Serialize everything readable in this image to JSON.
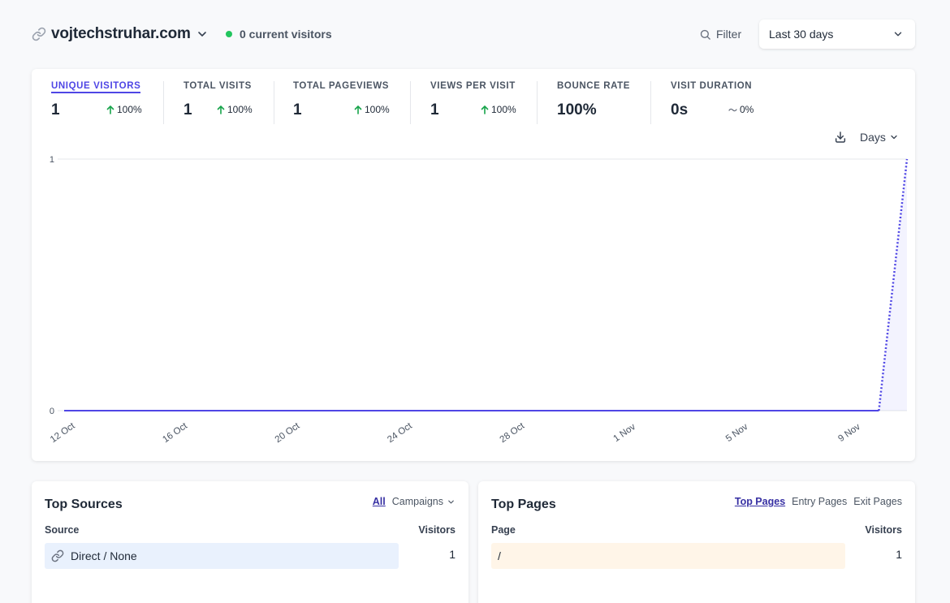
{
  "header": {
    "site_name": "vojtechstruhar.com",
    "live_visitors": "0 current visitors",
    "filter_label": "Filter",
    "date_range": "Last 30 days"
  },
  "metrics": [
    {
      "label": "UNIQUE VISITORS",
      "value": "1",
      "change": "100%",
      "trend": "up",
      "active": true
    },
    {
      "label": "TOTAL VISITS",
      "value": "1",
      "change": "100%",
      "trend": "up",
      "active": false
    },
    {
      "label": "TOTAL PAGEVIEWS",
      "value": "1",
      "change": "100%",
      "trend": "up",
      "active": false
    },
    {
      "label": "VIEWS PER VISIT",
      "value": "1",
      "change": "100%",
      "trend": "up",
      "active": false
    },
    {
      "label": "BOUNCE RATE",
      "value": "100%",
      "change": "",
      "trend": "none",
      "active": false
    },
    {
      "label": "VISIT DURATION",
      "value": "0s",
      "change": "0%",
      "trend": "flat",
      "active": false
    }
  ],
  "interval_label": "Days",
  "colors": {
    "accent": "#4f46e5",
    "live_dot": "#22c55e",
    "trend_up": "#16a34a",
    "sources_bar": "#e9f1fd",
    "pages_bar": "#fff5e8"
  },
  "chart_data": {
    "type": "line",
    "x_tick_labels": [
      "12 Oct",
      "16 Oct",
      "20 Oct",
      "24 Oct",
      "28 Oct",
      "1 Nov",
      "5 Nov",
      "9 Nov"
    ],
    "y_tick_labels": [
      "0",
      "1"
    ],
    "ylim": [
      0,
      1
    ],
    "x_start": "12 Oct",
    "series": [
      {
        "values": [
          0,
          0,
          0,
          0,
          0,
          0,
          0,
          0,
          0,
          0,
          0,
          0,
          0,
          0,
          0,
          0,
          0,
          0,
          0,
          0,
          0,
          0,
          0,
          0,
          0,
          0,
          0,
          0,
          0,
          0,
          1
        ]
      }
    ],
    "grid": true
  },
  "top_sources": {
    "title": "Top Sources",
    "tabs": [
      "All",
      "Campaigns"
    ],
    "active_tab": "All",
    "col_source": "Source",
    "col_visitors": "Visitors",
    "rows": [
      {
        "label": "Direct / None",
        "visitors": "1",
        "share": 1.0
      }
    ]
  },
  "top_pages": {
    "title": "Top Pages",
    "tabs": [
      "Top Pages",
      "Entry Pages",
      "Exit Pages"
    ],
    "active_tab": "Top Pages",
    "col_page": "Page",
    "col_visitors": "Visitors",
    "rows": [
      {
        "label": "/",
        "visitors": "1",
        "share": 1.0
      }
    ]
  }
}
